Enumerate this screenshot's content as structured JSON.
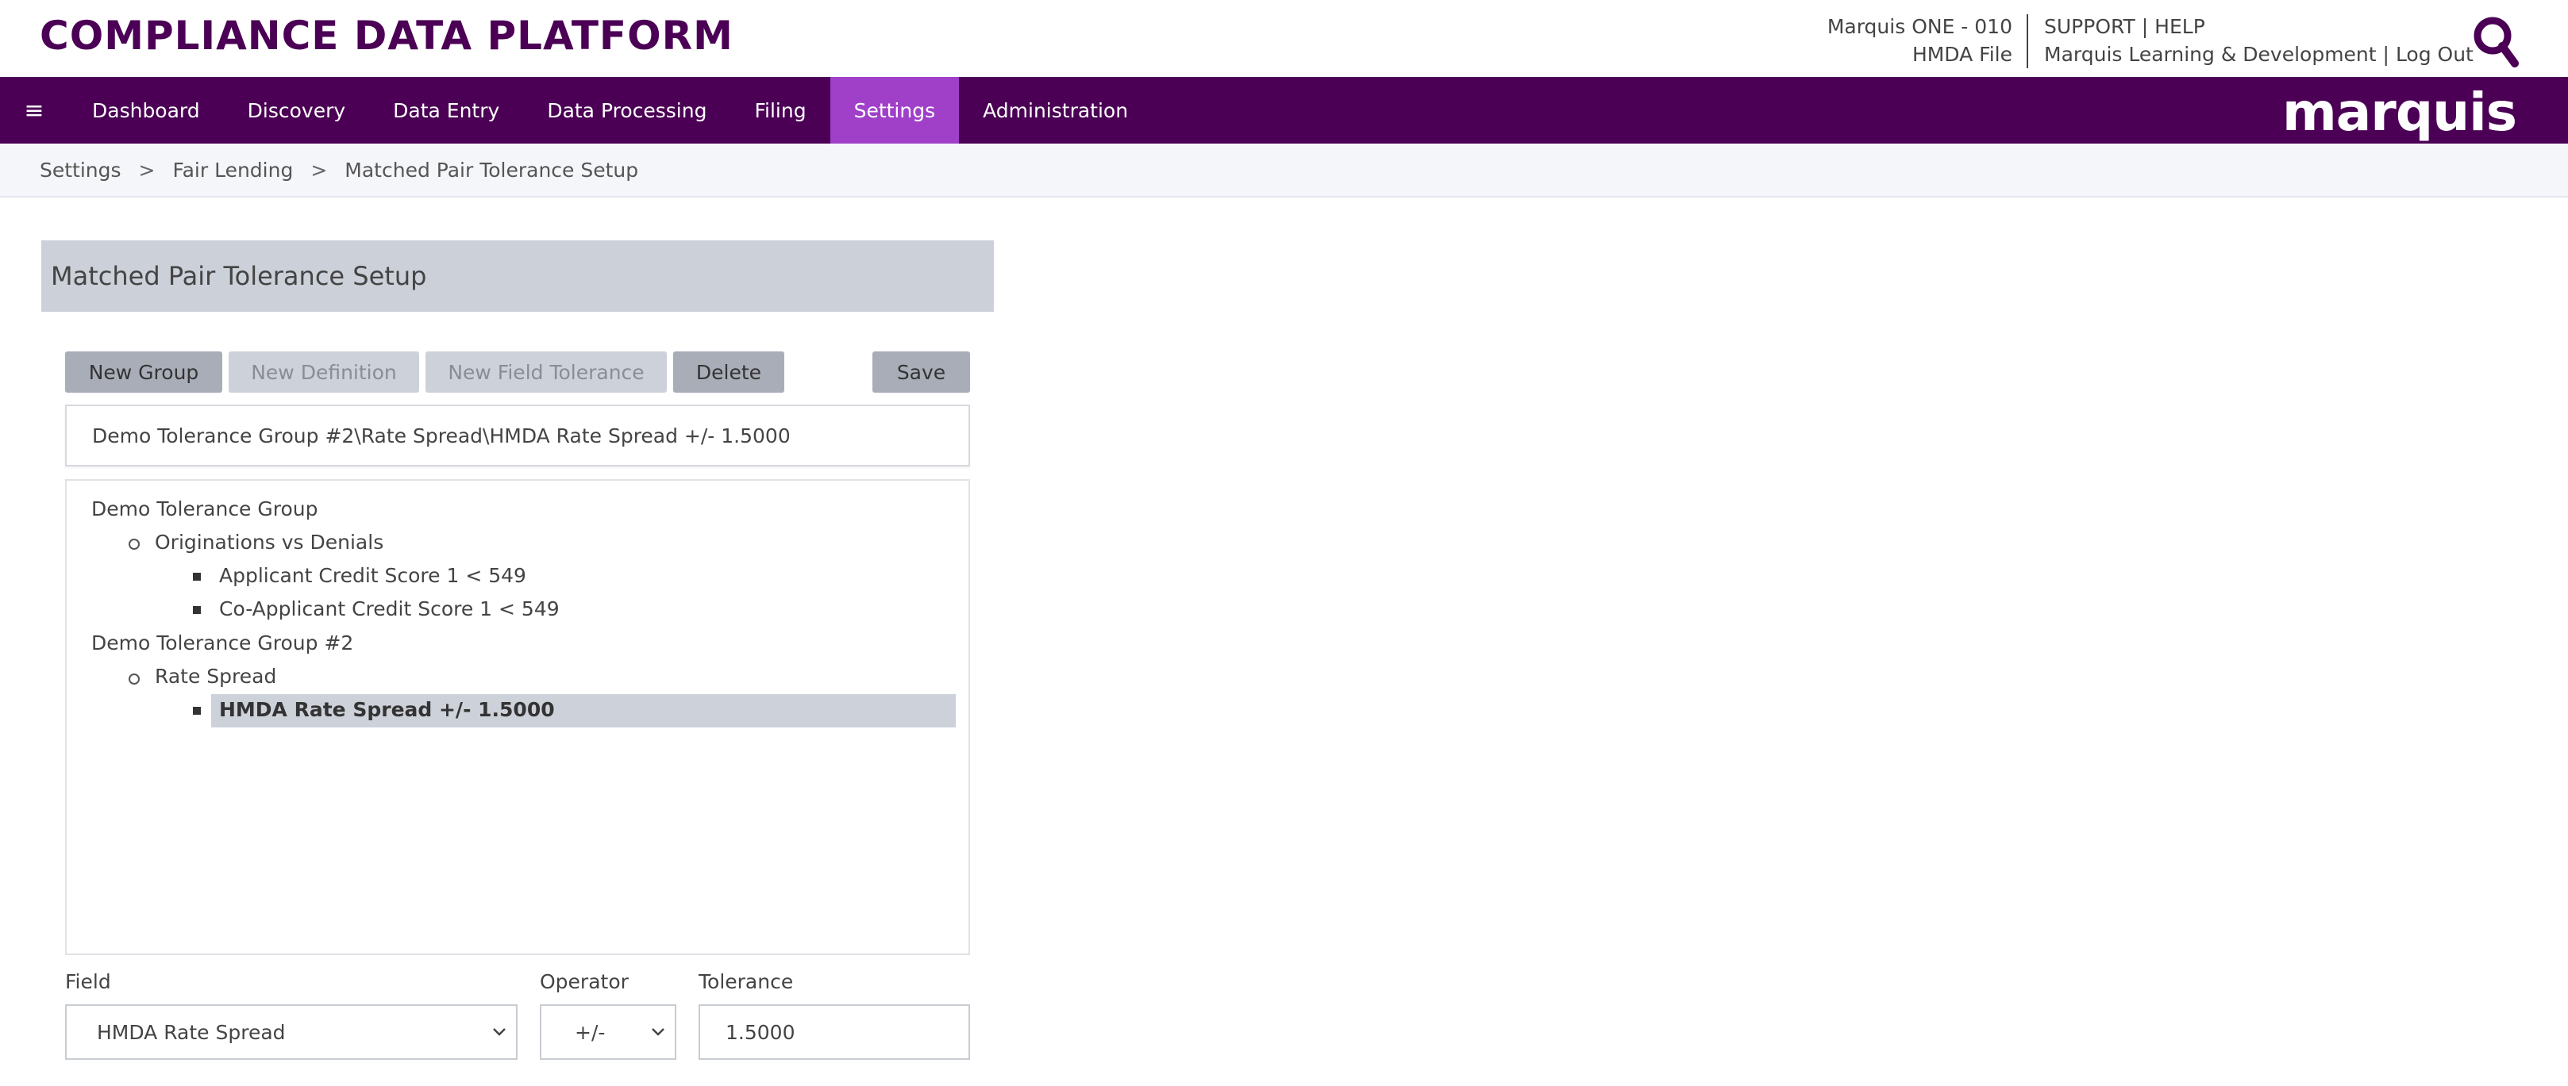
{
  "header": {
    "brand": "COMPLIANCE DATA PLATFORM",
    "account_line1": "Marquis ONE - 010",
    "account_line2": "HMDA File",
    "support": "SUPPORT",
    "help": "HELP",
    "user": "Marquis Learning & Development",
    "logout": "Log Out",
    "sep": "|"
  },
  "nav": {
    "menu_icon": "≡",
    "items": [
      "Dashboard",
      "Discovery",
      "Data Entry",
      "Data Processing",
      "Filing",
      "Settings",
      "Administration"
    ],
    "active": "Settings",
    "logo": "marquis"
  },
  "breadcrumb": {
    "items": [
      "Settings",
      "Fair Lending",
      "Matched Pair Tolerance Setup"
    ],
    "sep": ">"
  },
  "panel": {
    "title": "Matched Pair Tolerance Setup",
    "buttons": {
      "new_group": "New Group",
      "new_definition": "New Definition",
      "new_field_tolerance": "New Field Tolerance",
      "delete": "Delete",
      "save": "Save"
    },
    "selected_path": "Demo Tolerance Group #2\\Rate Spread\\HMDA Rate Spread +/- 1.5000",
    "tree": {
      "g1": "Demo Tolerance Group",
      "g1_d1": "Originations vs Denials",
      "g1_d1_f1": "Applicant Credit Score 1 < 549",
      "g1_d1_f2": "Co-Applicant Credit Score 1 < 549",
      "g2": "Demo Tolerance Group #2",
      "g2_d1": "Rate Spread",
      "g2_d1_f1": "HMDA Rate Spread +/- 1.5000"
    },
    "form": {
      "field_label": "Field",
      "field_value": "HMDA Rate Spread",
      "operator_label": "Operator",
      "operator_value": "+/-",
      "tolerance_label": "Tolerance",
      "tolerance_value": "1.5000"
    }
  },
  "colors": {
    "brand": "#4b0055",
    "nav_active": "#a040c8"
  }
}
